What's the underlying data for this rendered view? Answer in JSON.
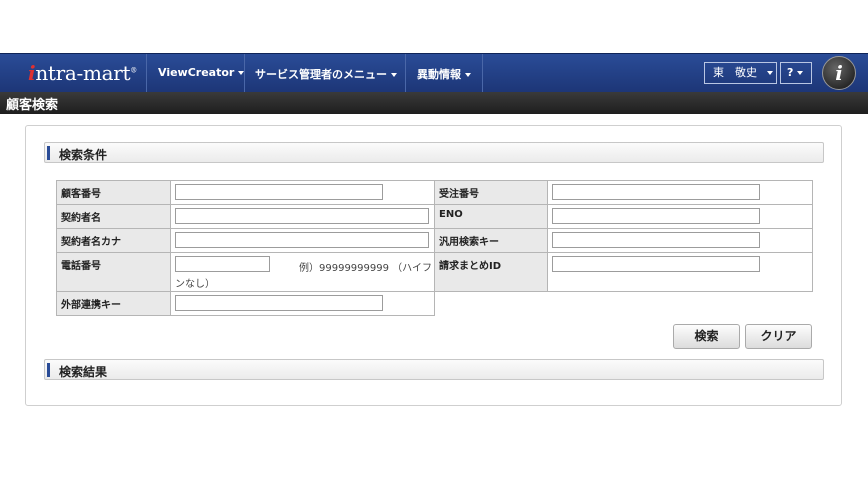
{
  "header": {
    "logo_prefix": "i",
    "logo_text": "ntra-mart",
    "logo_mark": "®",
    "menus": [
      {
        "label": "ViewCreator"
      },
      {
        "label": "サービス管理者のメニュー"
      },
      {
        "label": "異動情報"
      }
    ],
    "user_name": "東　敬史",
    "help_label": "?",
    "brand_logo_letter": "i"
  },
  "page_title": "顧客検索",
  "search_section": {
    "title": "検索条件",
    "fields": {
      "customer_no": {
        "label": "顧客番号",
        "value": ""
      },
      "order_no": {
        "label": "受注番号",
        "value": ""
      },
      "contractor_name": {
        "label": "契約者名",
        "value": ""
      },
      "eno": {
        "label": "ENO",
        "value": ""
      },
      "contractor_kana": {
        "label": "契約者名カナ",
        "value": ""
      },
      "generic_key": {
        "label": "汎用検索キー",
        "value": ""
      },
      "phone": {
        "label": "電話番号",
        "value": "",
        "hint_line1": "例）99999999999 （ハイフ",
        "hint_line2": "ンなし）"
      },
      "billing_id": {
        "label": "請求まとめID",
        "value": ""
      },
      "external_key": {
        "label": "外部連携キー",
        "value": ""
      }
    },
    "search_button": "検索",
    "clear_button": "クリア"
  },
  "results_section": {
    "title": "検索結果"
  },
  "icons": [
    "caret-down-icon",
    "intra-mart-logo"
  ],
  "colors": {
    "header_bg": "#1d3677",
    "title_bg": "#2a2a2a",
    "accent": "#2a4c97"
  }
}
